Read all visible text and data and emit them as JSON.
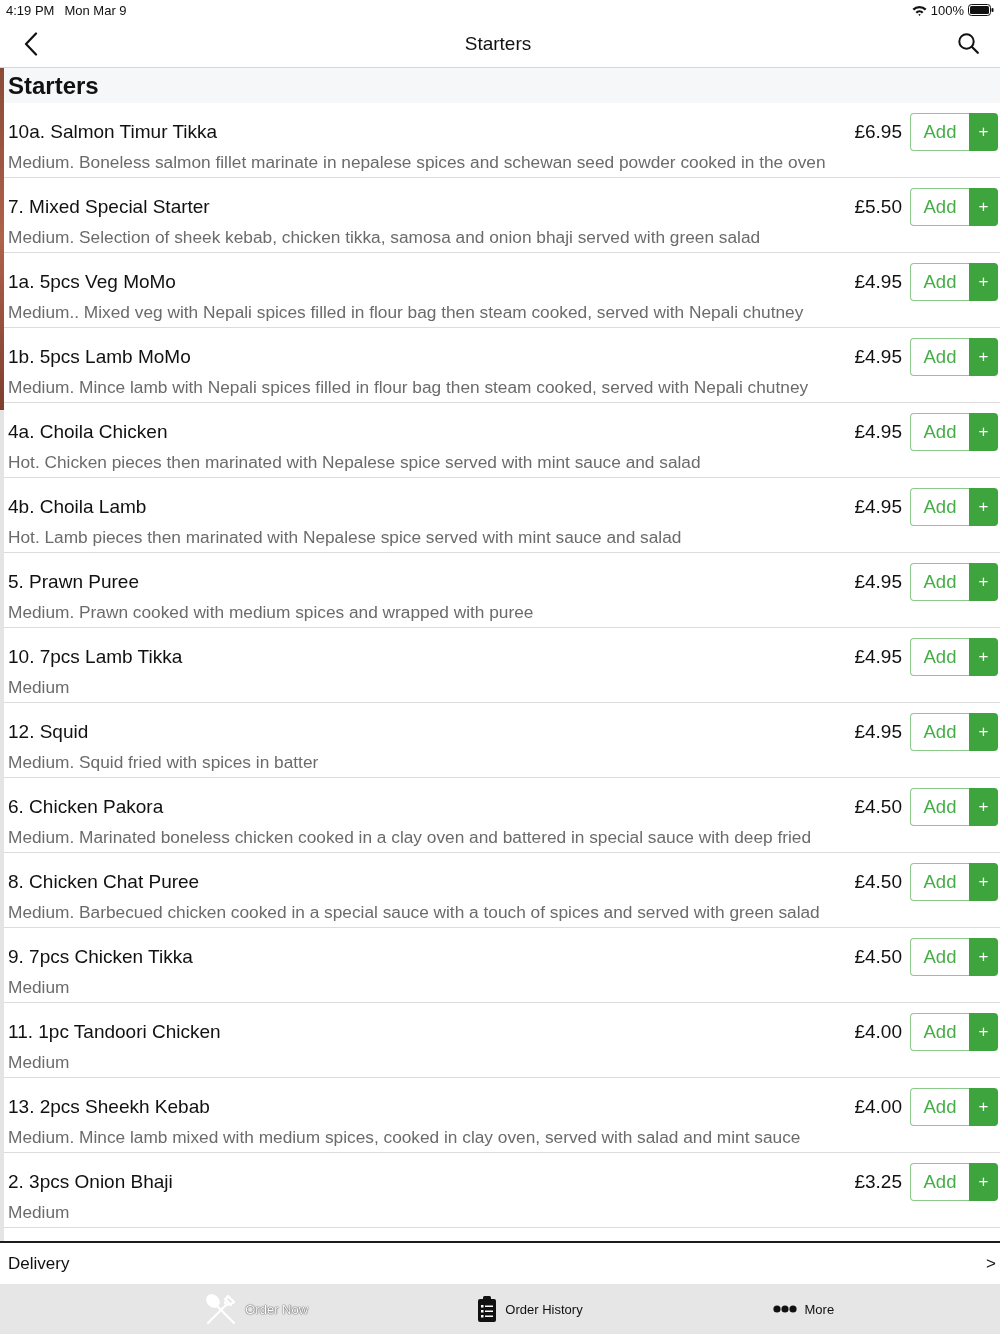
{
  "status_bar": {
    "time": "4:19 PM",
    "date": "Mon Mar 9",
    "battery": "100%"
  },
  "nav": {
    "title": "Starters"
  },
  "section": {
    "title": "Starters"
  },
  "items": [
    {
      "name": "10a. Salmon Timur Tikka",
      "description": "Medium. Boneless salmon fillet marinate in nepalese spices and schewan seed powder cooked in the oven",
      "price": "£6.95",
      "button": "Add",
      "plus": "+"
    },
    {
      "name": "7. Mixed Special Starter",
      "description": "Medium. Selection of sheek kebab, chicken tikka, samosa and onion bhaji served with green salad",
      "price": "£5.50",
      "button": "Add",
      "plus": "+"
    },
    {
      "name": "1a. 5pcs Veg MoMo",
      "description": "Medium.. Mixed veg with Nepali spices filled in flour bag then steam cooked, served with Nepali chutney",
      "price": "£4.95",
      "button": "Add",
      "plus": "+"
    },
    {
      "name": "1b. 5pcs Lamb MoMo",
      "description": "Medium. Mince lamb with Nepali spices filled in flour bag then steam cooked, served with Nepali chutney",
      "price": "£4.95",
      "button": "Add",
      "plus": "+"
    },
    {
      "name": "4a. Choila Chicken",
      "description": "Hot. Chicken pieces then marinated with Nepalese spice served with mint sauce and salad",
      "price": "£4.95",
      "button": "Add",
      "plus": "+"
    },
    {
      "name": "4b. Choila Lamb",
      "description": "Hot. Lamb pieces then marinated with Nepalese spice served with mint sauce and salad",
      "price": "£4.95",
      "button": "Add",
      "plus": "+"
    },
    {
      "name": "5. Prawn Puree",
      "description": "Medium. Prawn cooked with medium spices and wrapped with puree",
      "price": "£4.95",
      "button": "Add",
      "plus": "+"
    },
    {
      "name": "10. 7pcs Lamb Tikka",
      "description": "Medium",
      "price": "£4.95",
      "button": "Add",
      "plus": "+"
    },
    {
      "name": "12. Squid",
      "description": "Medium. Squid fried with spices in batter",
      "price": "£4.95",
      "button": "Add",
      "plus": "+"
    },
    {
      "name": "6. Chicken Pakora",
      "description": "Medium. Marinated boneless chicken cooked in a clay oven and battered in special sauce with deep fried",
      "price": "£4.50",
      "button": "Add",
      "plus": "+"
    },
    {
      "name": "8. Chicken Chat Puree",
      "description": "Medium. Barbecued chicken cooked in a special sauce with a touch of spices and served with green salad",
      "price": "£4.50",
      "button": "Add",
      "plus": "+"
    },
    {
      "name": "9. 7pcs Chicken Tikka",
      "description": "Medium",
      "price": "£4.50",
      "button": "Add",
      "plus": "+"
    },
    {
      "name": "11. 1pc Tandoori Chicken",
      "description": "Medium",
      "price": "£4.00",
      "button": "Add",
      "plus": "+"
    },
    {
      "name": "13. 2pcs Sheekh Kebab",
      "description": "Medium. Mince lamb mixed with medium spices, cooked in clay oven, served with salad and mint sauce",
      "price": "£4.00",
      "button": "Add",
      "plus": "+"
    },
    {
      "name": "2. 3pcs Onion Bhaji",
      "description": "Medium",
      "price": "£3.25",
      "button": "Add",
      "plus": "+"
    }
  ],
  "delivery": {
    "label": "Delivery",
    "chevron": ">"
  },
  "tab_bar": [
    {
      "label": "Order Now",
      "selected": true
    },
    {
      "label": "Order History",
      "selected": false
    },
    {
      "label": "More",
      "selected": false
    }
  ]
}
